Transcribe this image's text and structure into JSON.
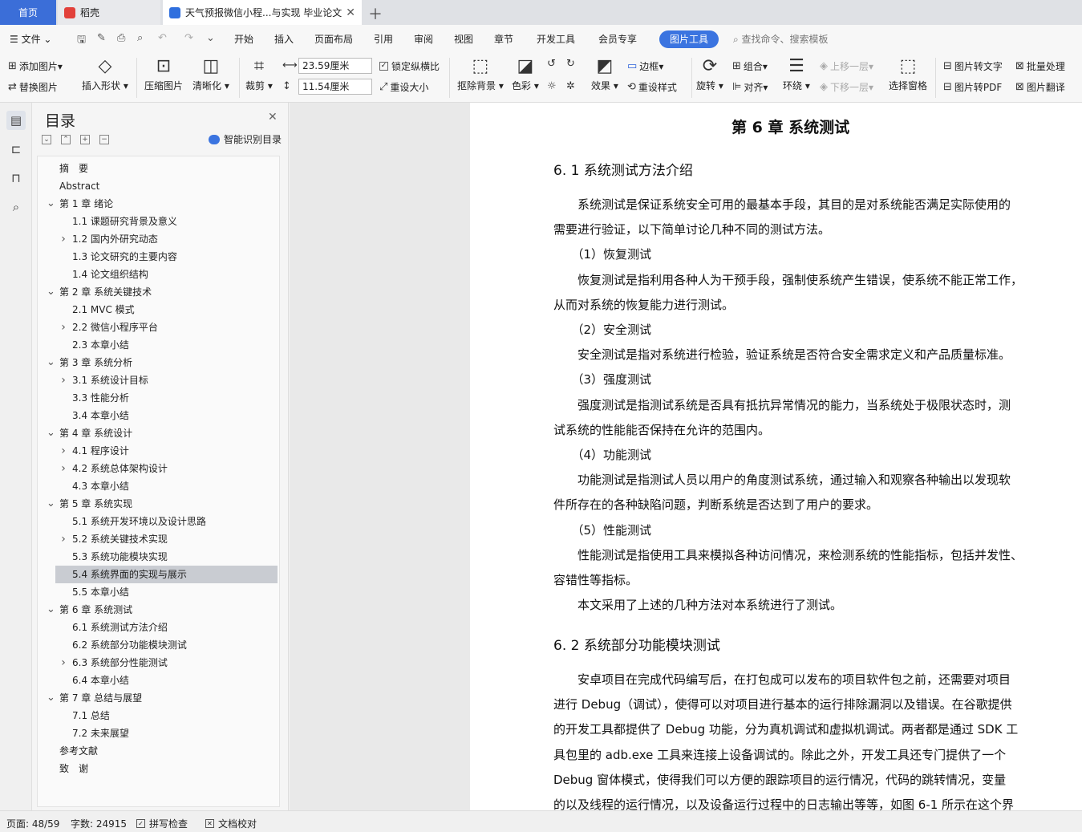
{
  "tabs": [
    {
      "label": "首页"
    },
    {
      "label": "稻壳"
    },
    {
      "label": "天气预报微信小程...与实现 毕业论文"
    }
  ],
  "menu": {
    "file": "文件",
    "items": [
      "开始",
      "插入",
      "页面布局",
      "引用",
      "审阅",
      "视图",
      "章节",
      "开发工具",
      "会员专享"
    ],
    "active": "图片工具",
    "search_placeholder": "查找命令、搜索模板"
  },
  "ribbon": {
    "add_image": "添加图片",
    "replace_image": "替换图片",
    "insert_shape": "插入形状",
    "compress_image": "压缩图片",
    "sharpen": "清晰化",
    "crop": "裁剪",
    "width": "23.59厘米",
    "height": "11.54厘米",
    "lock_ratio": "锁定纵横比",
    "reset_size": "重设大小",
    "remove_bg": "抠除背景",
    "color": "色彩",
    "effects": "效果",
    "border": "边框",
    "reset_style": "重设样式",
    "rotate": "旋转",
    "group": "组合",
    "align": "对齐",
    "wrap": "环绕",
    "bring_forward": "上移一层",
    "send_backward": "下移一层",
    "select_pane": "选择窗格",
    "img_to_text": "图片转文字",
    "img_to_pdf": "图片转PDF",
    "batch": "批量处理",
    "img_translate": "图片翻译"
  },
  "toc": {
    "title": "目录",
    "smart_label": "智能识别目录",
    "items": [
      {
        "text": "摘　要",
        "level": 0,
        "arrow": ""
      },
      {
        "text": "Abstract",
        "level": 0,
        "arrow": ""
      },
      {
        "text": "第 1 章  绪论",
        "level": 0,
        "arrow": "v"
      },
      {
        "text": "1.1 课题研究背景及意义",
        "level": 1,
        "arrow": ""
      },
      {
        "text": "1.2 国内外研究动态",
        "level": 1,
        "arrow": ">"
      },
      {
        "text": "1.3 论文研究的主要内容",
        "level": 1,
        "arrow": ""
      },
      {
        "text": "1.4 论文组织结构",
        "level": 1,
        "arrow": ""
      },
      {
        "text": "第 2 章  系统关键技术",
        "level": 0,
        "arrow": "v"
      },
      {
        "text": "2.1 MVC 模式",
        "level": 1,
        "arrow": ""
      },
      {
        "text": "2.2  微信小程序平台",
        "level": 1,
        "arrow": ">"
      },
      {
        "text": "2.3 本章小结",
        "level": 1,
        "arrow": ""
      },
      {
        "text": "第 3 章  系统分析",
        "level": 0,
        "arrow": "v"
      },
      {
        "text": "3.1 系统设计目标",
        "level": 1,
        "arrow": ">"
      },
      {
        "text": "3.3 性能分析",
        "level": 1,
        "arrow": ""
      },
      {
        "text": "3.4 本章小结",
        "level": 1,
        "arrow": ""
      },
      {
        "text": "第 4 章  系统设计",
        "level": 0,
        "arrow": "v"
      },
      {
        "text": "4.1 程序设计",
        "level": 1,
        "arrow": ">"
      },
      {
        "text": "4.2 系统总体架构设计",
        "level": 1,
        "arrow": ">"
      },
      {
        "text": "4.3 本章小结",
        "level": 1,
        "arrow": ""
      },
      {
        "text": "第 5 章  系统实现",
        "level": 0,
        "arrow": "v"
      },
      {
        "text": "5.1 系统开发环境以及设计思路",
        "level": 1,
        "arrow": ""
      },
      {
        "text": "5.2 系统关键技术实现",
        "level": 1,
        "arrow": ">"
      },
      {
        "text": "5.3 系统功能模块实现",
        "level": 1,
        "arrow": ""
      },
      {
        "text": "5.4 系统界面的实现与展示",
        "level": 1,
        "arrow": "",
        "selected": true
      },
      {
        "text": "5.5 本章小结",
        "level": 1,
        "arrow": ""
      },
      {
        "text": "第 6 章  系统测试",
        "level": 0,
        "arrow": "v"
      },
      {
        "text": "6.1 系统测试方法介绍",
        "level": 1,
        "arrow": ""
      },
      {
        "text": "6.2 系统部分功能模块测试",
        "level": 1,
        "arrow": ""
      },
      {
        "text": "6.3 系统部分性能测试",
        "level": 1,
        "arrow": ">"
      },
      {
        "text": "6.4 本章小结",
        "level": 1,
        "arrow": ""
      },
      {
        "text": "第 7 章  总结与展望",
        "level": 0,
        "arrow": "v"
      },
      {
        "text": "7.1 总结",
        "level": 1,
        "arrow": ""
      },
      {
        "text": "7.2 未来展望",
        "level": 1,
        "arrow": ""
      },
      {
        "text": "参考文献",
        "level": 0,
        "arrow": ""
      },
      {
        "text": "致　谢",
        "level": 0,
        "arrow": ""
      }
    ]
  },
  "doc": {
    "chapter_title": "第 6 章  系统测试",
    "s1_title": "6. 1 系统测试方法介绍",
    "s2_title": "6. 2 系统部分功能模块测试",
    "lines": [
      "　　系统测试是保证系统安全可用的最基本手段，其目的是对系统能否满足实际使用的",
      "需要进行验证，以下简单讨论几种不同的测试方法。",
      "　　（1）恢复测试",
      "　　恢复测试是指利用各种人为干预手段，强制使系统产生错误，使系统不能正常工作，",
      "从而对系统的恢复能力进行测试。",
      "　　（2）安全测试",
      "　　安全测试是指对系统进行检验，验证系统是否符合安全需求定义和产品质量标准。",
      "　　（3）强度测试",
      "　　强度测试是指测试系统是否具有抵抗异常情况的能力，当系统处于极限状态时，测",
      "试系统的性能能否保持在允许的范围内。",
      "　　（4）功能测试",
      "　　功能测试是指测试人员以用户的角度测试系统，通过输入和观察各种输出以发现软",
      "件所存在的各种缺陷问题，判断系统是否达到了用户的要求。",
      "　　（5）性能测试",
      "　　性能测试是指使用工具来模拟各种访问情况，来检测系统的性能指标，包括并发性、",
      "容错性等指标。",
      "　　本文采用了上述的几种方法对本系统进行了测试。"
    ],
    "lines2": [
      "　　安卓项目在完成代码编写后，在打包成可以发布的项目软件包之前，还需要对项目",
      "进行 Debug（调试），使得可以对项目进行基本的运行排除漏洞以及错误。在谷歌提供",
      "的开发工具都提供了 Debug 功能，分为真机调试和虚拟机调试。两者都是通过 SDK 工",
      "具包里的 adb.exe 工具来连接上设备调试的。除此之外，开发工具还专门提供了一个",
      "Debug  窗体模式，使得我们可以方便的跟踪项目的运行情况，代码的跳转情况，变量",
      "的以及线程的运行情况，以及设备运行过程中的日志输出等等，如图 6-1 所示在这个界"
    ]
  },
  "status": {
    "page": "页面: 48/59",
    "words": "字数: 24915",
    "spell": "拼写检查",
    "proof": "文档校对"
  }
}
